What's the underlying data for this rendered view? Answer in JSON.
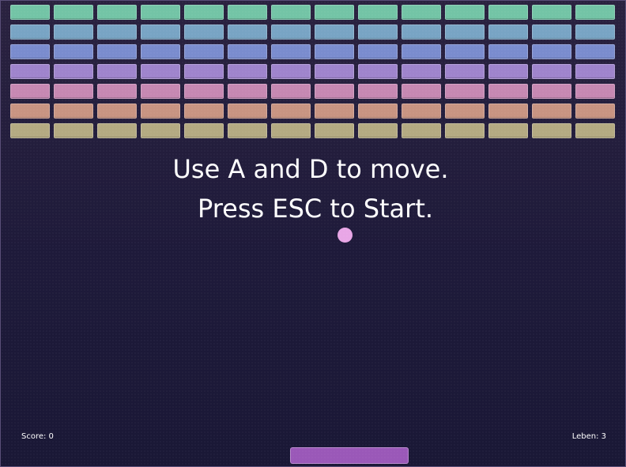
{
  "colors": {
    "background": "#1e1a3a",
    "ball": "#e8a6e6",
    "paddle": "#9a58b8",
    "text": "#ffffff"
  },
  "bricks": {
    "columns": 14,
    "row_colors": [
      "#73c4a6",
      "#78a4c4",
      "#7a8cce",
      "#9f84cc",
      "#c688b2",
      "#c89482",
      "#b4aa82"
    ]
  },
  "message": {
    "line1": "Use A and D to move.",
    "line2": "Press ESC to Start."
  },
  "hud": {
    "score_text": "Score: 0",
    "lives_text": "Leben: 3"
  }
}
